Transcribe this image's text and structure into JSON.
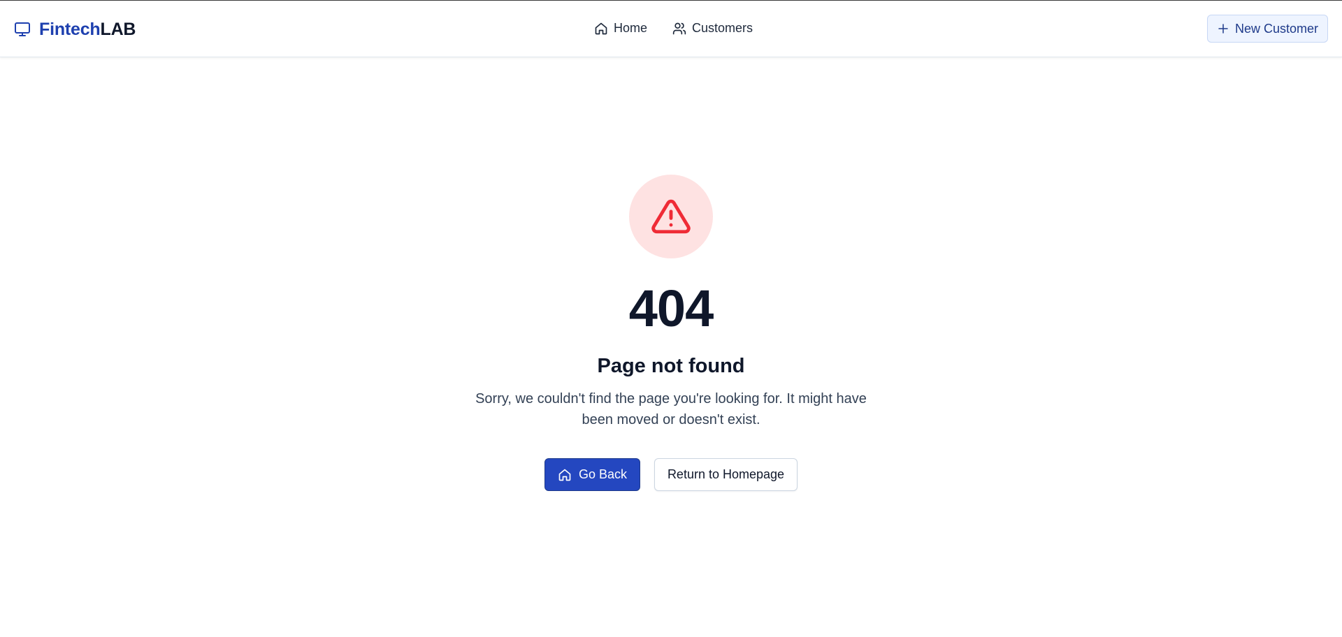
{
  "header": {
    "brand": {
      "part1": "Fintech",
      "part2": "LAB",
      "icon": "monitor-icon"
    },
    "nav": [
      {
        "label": "Home",
        "icon": "home-icon"
      },
      {
        "label": "Customers",
        "icon": "users-icon"
      }
    ],
    "new_customer": {
      "label": "New Customer",
      "icon": "plus-icon"
    }
  },
  "error": {
    "icon": "alert-triangle-icon",
    "code": "404",
    "title": "Page not found",
    "description": "Sorry, we couldn't find the page you're looking for. It might have been moved or doesn't exist."
  },
  "actions": {
    "go_back": {
      "label": "Go Back",
      "icon": "home-icon"
    },
    "return_home": {
      "label": "Return to Homepage"
    }
  },
  "colors": {
    "brand_blue": "#1e40af",
    "primary_button": "#2447c0",
    "alert_red": "#ef2b36",
    "alert_bg": "#fee2e2",
    "text_dark": "#0f172a"
  }
}
